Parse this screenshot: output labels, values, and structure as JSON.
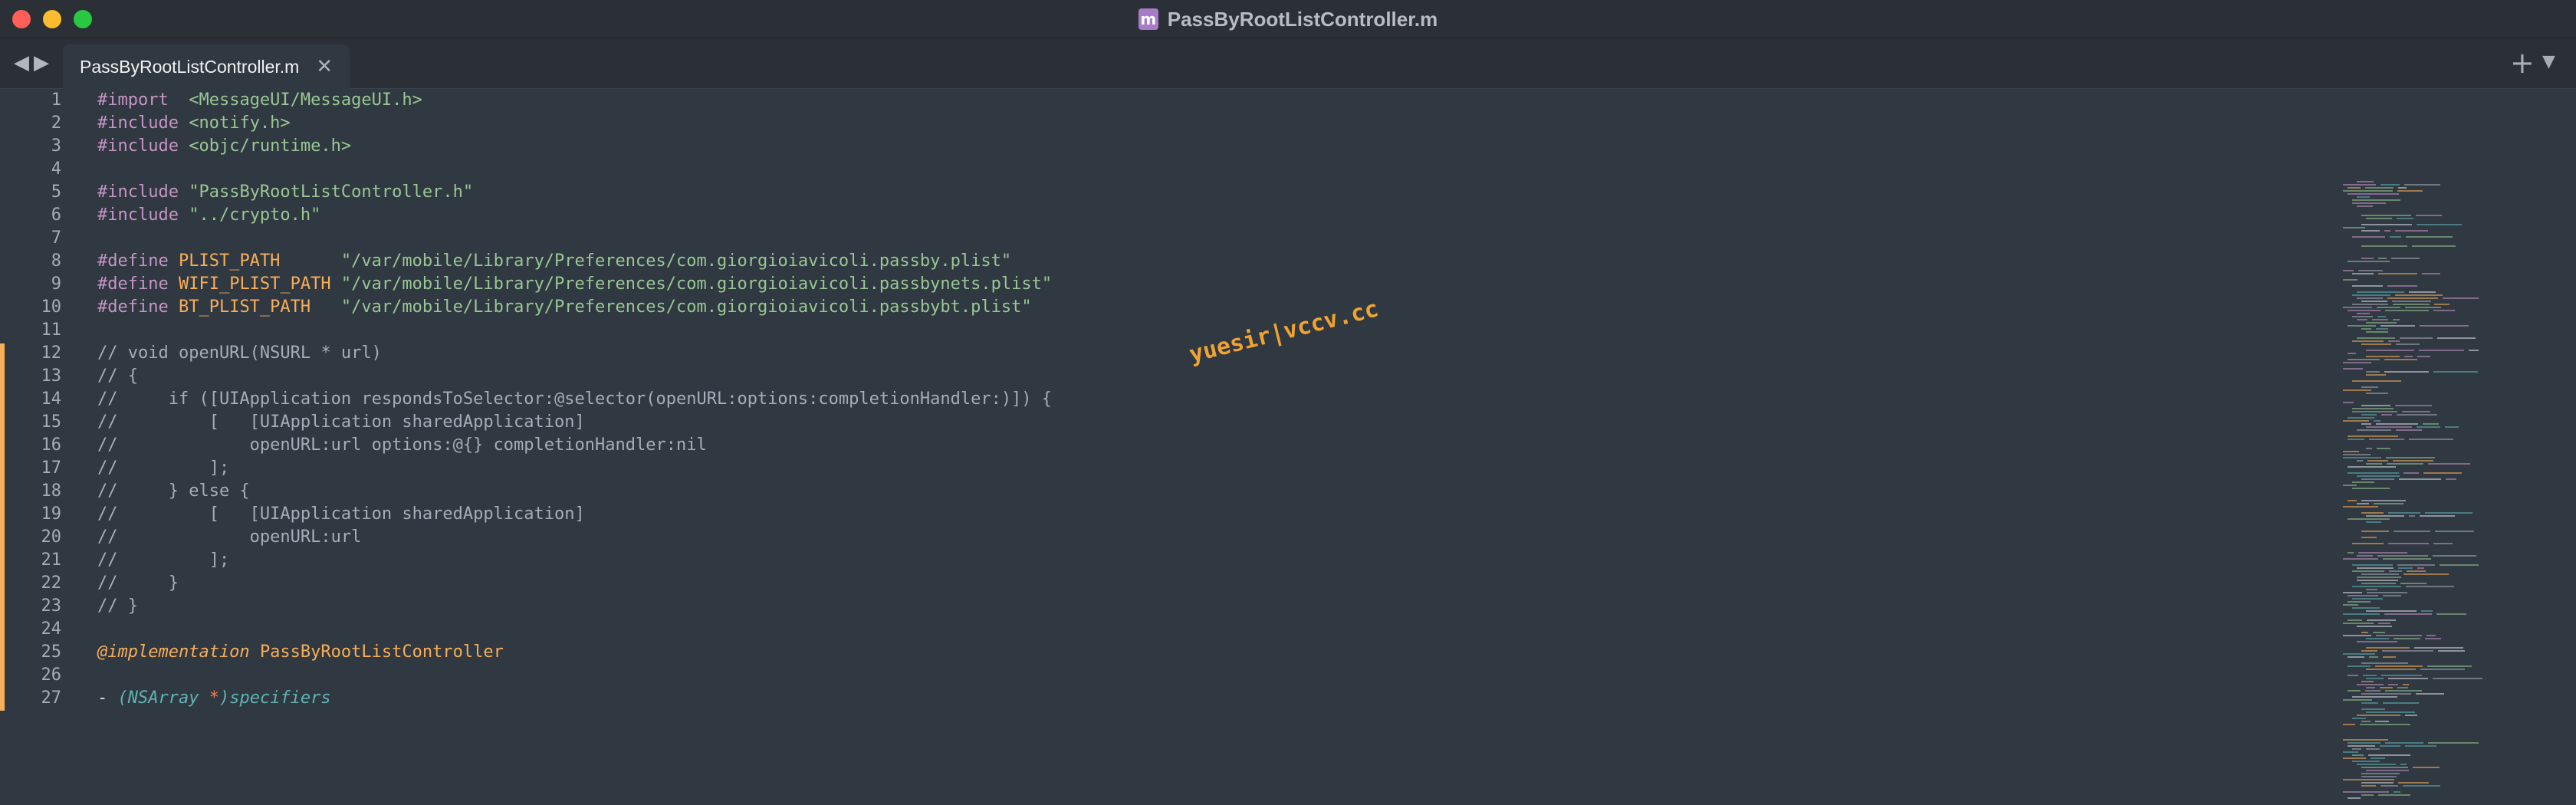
{
  "window": {
    "title": "PassByRootListController.m",
    "file_icon_letter": "m",
    "traffic_lights": {
      "close": "#ff5f57",
      "minimize": "#febc2e",
      "zoom": "#28c840"
    }
  },
  "tabbar": {
    "nav_back_icon": "◀",
    "nav_forward_icon": "▶",
    "tab_label": "PassByRootListController.m",
    "tab_close_icon": "✕",
    "new_tab_icon": "+",
    "tab_menu_icon": "▼"
  },
  "editor": {
    "theme": {
      "background": "#303841",
      "comment": "#a6acb9",
      "string": "#99c794",
      "preprocessor": "#c695c6",
      "macro": "#f9ae58",
      "type": "#5fb4b4"
    },
    "modified_marker_color": "#f9ae58",
    "line_numbers": [
      "1",
      "2",
      "3",
      "4",
      "5",
      "6",
      "7",
      "8",
      "9",
      "10",
      "11",
      "12",
      "13",
      "14",
      "15",
      "16",
      "17",
      "18",
      "19",
      "20",
      "21",
      "22",
      "23",
      "24",
      "25",
      "26",
      "27"
    ],
    "lines": {
      "l1": {
        "d": "#import ",
        "s": "<MessageUI/MessageUI.h>"
      },
      "l2": {
        "d": "#include",
        "s": "<notify.h>"
      },
      "l3": {
        "d": "#include",
        "s": "<objc/runtime.h>"
      },
      "l5": {
        "d": "#include",
        "s": "\"PassByRootListController.h\""
      },
      "l6": {
        "d": "#include",
        "s": "\"../crypto.h\""
      },
      "l8": {
        "d": "#define",
        "m": "PLIST_PATH     ",
        "s": "\"/var/mobile/Library/Preferences/com.giorgioiavicoli.passby.plist\""
      },
      "l9": {
        "d": "#define",
        "m": "WIFI_PLIST_PATH",
        "s": "\"/var/mobile/Library/Preferences/com.giorgioiavicoli.passbynets.plist\""
      },
      "l10": {
        "d": "#define",
        "m": "BT_PLIST_PATH  ",
        "s": "\"/var/mobile/Library/Preferences/com.giorgioiavicoli.passbybt.plist\""
      },
      "l12": "// void openURL(NSURL * url)",
      "l13": "// {",
      "l14": "//     if ([UIApplication respondsToSelector:@selector(openURL:options:completionHandler:)]) {",
      "l15": "//         [   [UIApplication sharedApplication]",
      "l16": "//             openURL:url options:@{} completionHandler:nil",
      "l17": "//         ];",
      "l18": "//     } else {",
      "l19": "//         [   [UIApplication sharedApplication]",
      "l20": "//             openURL:url",
      "l21": "//         ];",
      "l22": "//     }",
      "l23": "// }",
      "l25": {
        "kw": "@implementation",
        "cls": "PassByRootListController"
      },
      "l27": {
        "minus": "-",
        "open": "(",
        "type": "NSArray",
        "star": "*",
        "rest": ")specifiers"
      }
    }
  },
  "watermark": "yuesir|vccv.cc"
}
